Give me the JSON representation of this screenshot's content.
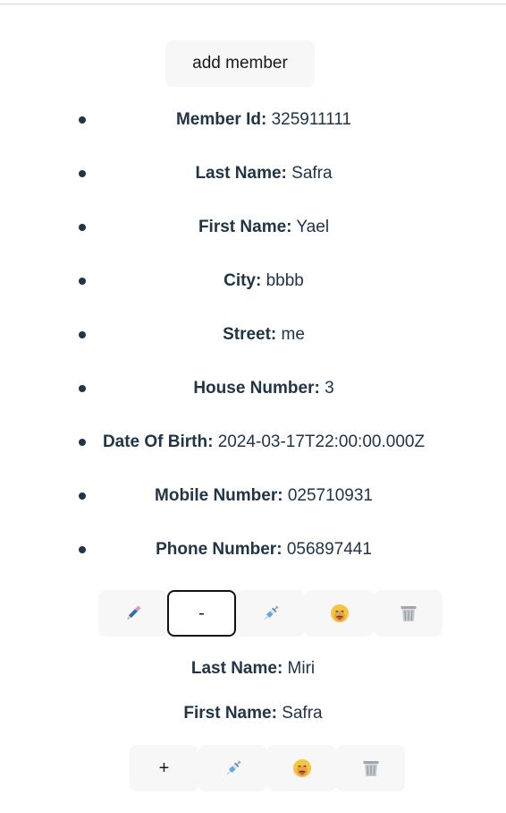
{
  "add_button_label": "add member",
  "member": {
    "fields": [
      {
        "label": "Member Id:",
        "value": "325911111"
      },
      {
        "label": "Last Name:",
        "value": "Safra"
      },
      {
        "label": "First Name:",
        "value": "Yael"
      },
      {
        "label": "City:",
        "value": "bbbb"
      },
      {
        "label": "Street:",
        "value": "me"
      },
      {
        "label": "House Number:",
        "value": "3"
      },
      {
        "label": "Date Of Birth:",
        "value": "2024-03-17T22:00:00.000Z"
      },
      {
        "label": "Mobile Number:",
        "value": "025710931"
      },
      {
        "label": "Phone Number:",
        "value": "056897441"
      }
    ],
    "actions": {
      "edit_icon": "pencil-icon",
      "collapse_label": "-",
      "vaccine_icon": "syringe-icon",
      "sick_icon": "sick-face-icon",
      "delete_icon": "wastebasket-icon"
    },
    "details": {
      "last_name_label": "Last Name:",
      "last_name_value": "Miri",
      "first_name_label": "First Name:",
      "first_name_value": "Safra"
    }
  },
  "second_actions": {
    "expand_label": "+",
    "vaccine_icon": "syringe-icon",
    "sick_icon": "sick-face-icon",
    "delete_icon": "wastebasket-icon"
  },
  "colors": {
    "text": "#213547",
    "button_bg": "#f7f7f7",
    "focus_border": "#111111"
  }
}
